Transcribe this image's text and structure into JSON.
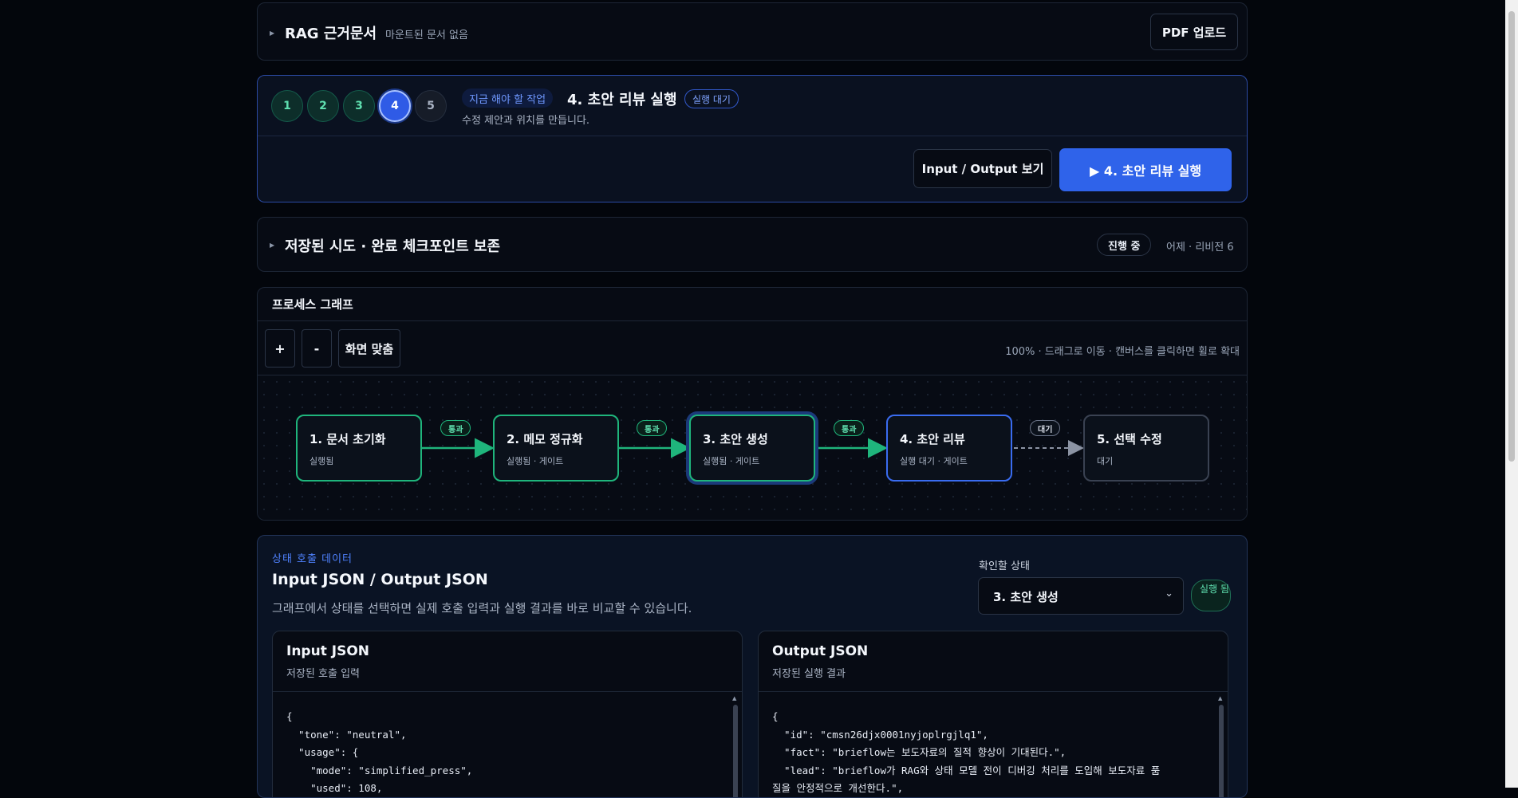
{
  "rag": {
    "title": "RAG 근거문서",
    "subtitle": "마운트된 문서 없음",
    "upload_button": "PDF 업로드"
  },
  "stepper": {
    "steps": [
      "1",
      "2",
      "3",
      "4",
      "5"
    ],
    "now_chip": "지금 해야 할 작업",
    "title": "4. 초안 리뷰 실행",
    "status_chip": "실행 대기",
    "subtitle": "수정 제안과 위치를 만듭니다.",
    "io_button": "Input / Output 보기",
    "run_button": "▶ 4. 초안 리뷰 실행"
  },
  "saved": {
    "title": "저장된 시도 · 완료 체크포인트 보존",
    "status": "진행 중",
    "meta": "어제 · 리비전 6"
  },
  "graph": {
    "title": "프로세스 그래프",
    "zoom_in": "+",
    "zoom_out": "-",
    "fit": "화면 맞춤",
    "hint": "100% · 드래그로 이동 · 캔버스를 클릭하면 휠로 확대",
    "nodes": [
      {
        "title": "1. 문서 초기화",
        "sub": "실행됨"
      },
      {
        "title": "2. 메모 정규화",
        "sub": "실행됨 · 게이트"
      },
      {
        "title": "3. 초안 생성",
        "sub": "실행됨 · 게이트"
      },
      {
        "title": "4. 초안 리뷰",
        "sub": "실행 대기 · 게이트"
      },
      {
        "title": "5. 선택 수정",
        "sub": "대기"
      }
    ],
    "edges": [
      "통과",
      "통과",
      "통과",
      "대기"
    ]
  },
  "state": {
    "eyebrow": "상태 호출 데이터",
    "title": "Input JSON / Output JSON",
    "desc": "그래프에서 상태를 선택하면 실제 호출 입력과 실행 결과를 바로 비교할 수 있습니다.",
    "select_label": "확인할 상태",
    "select_value": "3. 초안 생성",
    "badge": "실행 됨",
    "input": {
      "title": "Input JSON",
      "sub": "저장된 호출 입력",
      "code": "{\n  \"tone\": \"neutral\",\n  \"usage\": {\n    \"mode\": \"simplified_press\",\n    \"used\": 108,"
    },
    "output": {
      "title": "Output JSON",
      "sub": "저장된 실행 결과",
      "code": "{\n  \"id\": \"cmsn26djx0001nyjoplrgjlq1\",\n  \"fact\": \"brieflow는 보도자료의 질적 향상이 기대된다.\",\n  \"lead\": \"brieflow가 RAG와 상태 모델 전이 디버깅 처리를 도입해 보도자료 품\n질을 안정적으로 개선한다.\","
    }
  }
}
